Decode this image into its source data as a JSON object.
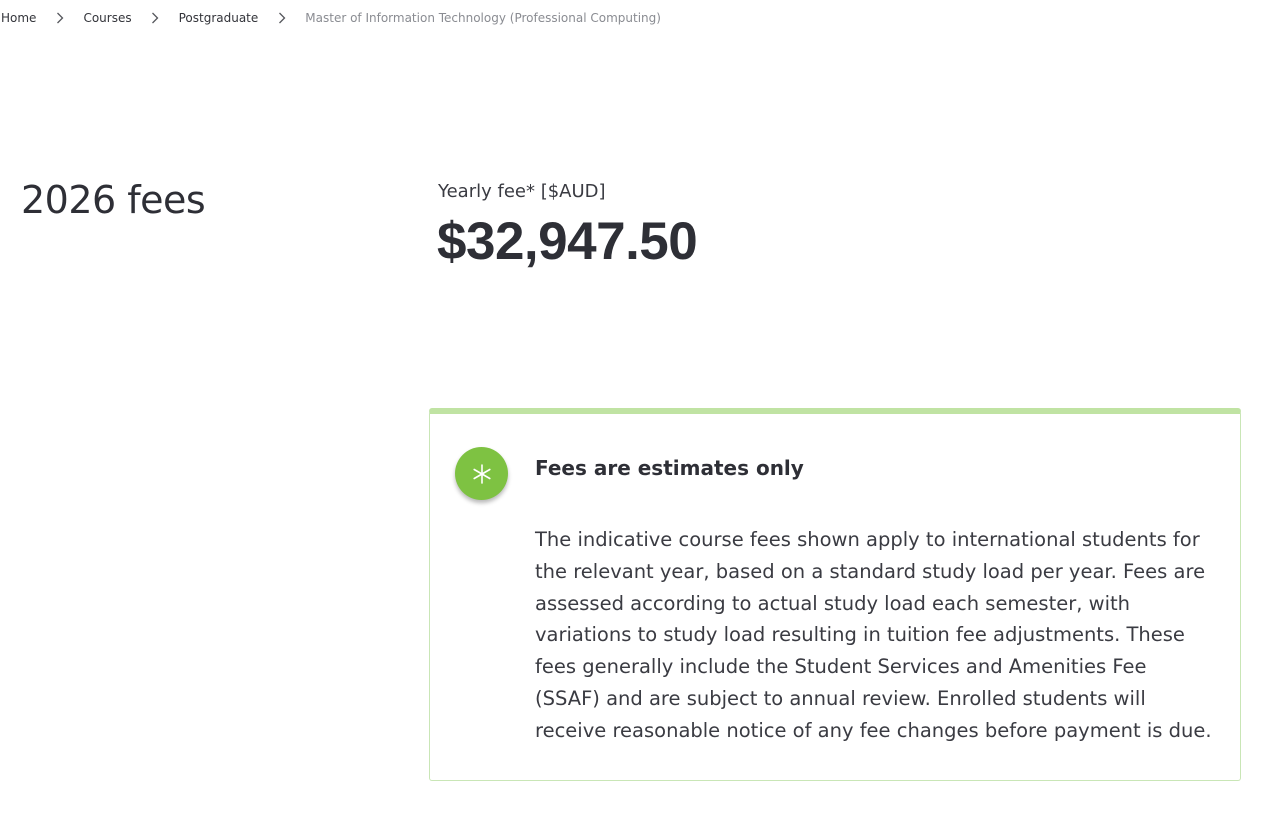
{
  "breadcrumb": {
    "items": [
      {
        "label": "Home"
      },
      {
        "label": "Courses"
      },
      {
        "label": "Postgraduate"
      }
    ],
    "current": "Master of Information Technology (Professional Computing)",
    "separator_icon": "chevron-right-icon"
  },
  "fees": {
    "heading": "2026 fees",
    "yearly_label": "Yearly fee* [$AUD]",
    "yearly_amount": "$32,947.50"
  },
  "notice": {
    "icon": "asterisk-icon",
    "icon_color": "#7ec242",
    "border_color": "#c0e3a3",
    "title": "Fees are estimates only",
    "body": "The indicative course fees shown apply to international students for the relevant year, based on a standard study load per year. Fees are assessed according to actual study load each semester, with variations to study load resulting in tuition fee adjustments. These fees generally include the Student Services and Amenities Fee (SSAF) and are subject to annual review. Enrolled students will receive reasonable notice of any fee changes before payment is due."
  }
}
